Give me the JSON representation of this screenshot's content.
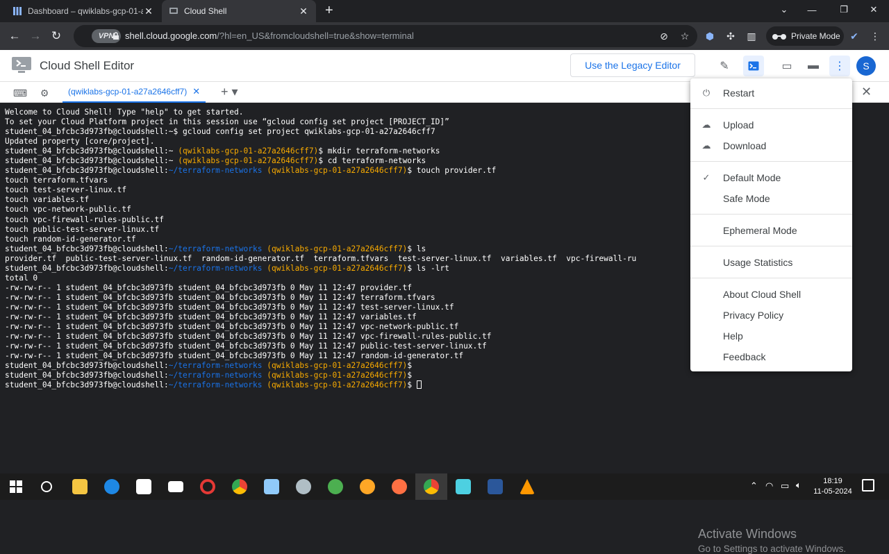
{
  "browser": {
    "tabs": [
      {
        "title": "Dashboard – qwiklabs-gcp-01-a",
        "active": false
      },
      {
        "title": "Cloud Shell",
        "active": true
      }
    ],
    "new_tab": "+",
    "address": {
      "vpn_label": "VPN",
      "host": "shell.cloud.google.com",
      "path": "/?hl=en_US&fromcloudshell=true&show=terminal"
    },
    "private_mode_label": "Private Mode"
  },
  "header": {
    "title": "Cloud Shell Editor",
    "legacy_button": "Use the Legacy Editor",
    "avatar_initial": "S"
  },
  "terminal_tab": {
    "label": "(qwiklabs-gcp-01-a27a2646cff7)",
    "close": "✕",
    "add": "+ ▾"
  },
  "terminal": {
    "user": "student_04_bfcbc3d973fb@cloudshell",
    "path": "~/terraform-networks",
    "project": "(qwiklabs-gcp-01-a27a2646cff7)",
    "welcome_1": "Welcome to Cloud Shell! Type \"help\" to get started.",
    "welcome_2": "To set your Cloud Platform project in this session use “gcloud config set project [PROJECT_ID]”",
    "cmd_gcloud": "gcloud config set project qwiklabs-gcp-01-a27a2646cff7",
    "updated": "Updated property [core/project].",
    "cmd_mkdir": "mkdir terraform-networks",
    "cmd_cd": "cd terraform-networks",
    "cmd_touch": "touch provider.tf",
    "touch_lines": [
      "touch terraform.tfvars",
      "touch test-server-linux.tf",
      "touch variables.tf",
      "touch vpc-network-public.tf",
      "touch vpc-firewall-rules-public.tf",
      "touch public-test-server-linux.tf",
      "touch random-id-generator.tf"
    ],
    "cmd_ls": "ls",
    "ls_output": "provider.tf  public-test-server-linux.tf  random-id-generator.tf  terraform.tfvars  test-server-linux.tf  variables.tf  vpc-firewall-ru                    c.tf",
    "cmd_lslrt": "ls -lrt",
    "total": "total 0",
    "lrt_lines": [
      "-rw-rw-r-- 1 student_04_bfcbc3d973fb student_04_bfcbc3d973fb 0 May 11 12:47 provider.tf",
      "-rw-rw-r-- 1 student_04_bfcbc3d973fb student_04_bfcbc3d973fb 0 May 11 12:47 terraform.tfvars",
      "-rw-rw-r-- 1 student_04_bfcbc3d973fb student_04_bfcbc3d973fb 0 May 11 12:47 test-server-linux.tf",
      "-rw-rw-r-- 1 student_04_bfcbc3d973fb student_04_bfcbc3d973fb 0 May 11 12:47 variables.tf",
      "-rw-rw-r-- 1 student_04_bfcbc3d973fb student_04_bfcbc3d973fb 0 May 11 12:47 vpc-network-public.tf",
      "-rw-rw-r-- 1 student_04_bfcbc3d973fb student_04_bfcbc3d973fb 0 May 11 12:47 vpc-firewall-rules-public.tf",
      "-rw-rw-r-- 1 student_04_bfcbc3d973fb student_04_bfcbc3d973fb 0 May 11 12:47 public-test-server-linux.tf",
      "-rw-rw-r-- 1 student_04_bfcbc3d973fb student_04_bfcbc3d973fb 0 May 11 12:47 random-id-generator.tf"
    ]
  },
  "menu": {
    "restart": "Restart",
    "upload": "Upload",
    "download": "Download",
    "default_mode": "Default Mode",
    "safe_mode": "Safe Mode",
    "ephemeral_mode": "Ephemeral Mode",
    "usage_statistics": "Usage Statistics",
    "about": "About Cloud Shell",
    "privacy": "Privacy Policy",
    "help": "Help",
    "feedback": "Feedback"
  },
  "watermark": {
    "line1": "Activate Windows",
    "line2": "Go to Settings to activate Windows."
  },
  "taskbar": {
    "time": "18:19",
    "date": "11-05-2024"
  },
  "colors": {
    "accent": "#1a73e8",
    "terminal_bg": "#202124",
    "prompt_path": "#1a73e8",
    "prompt_project": "#f9ab00"
  }
}
